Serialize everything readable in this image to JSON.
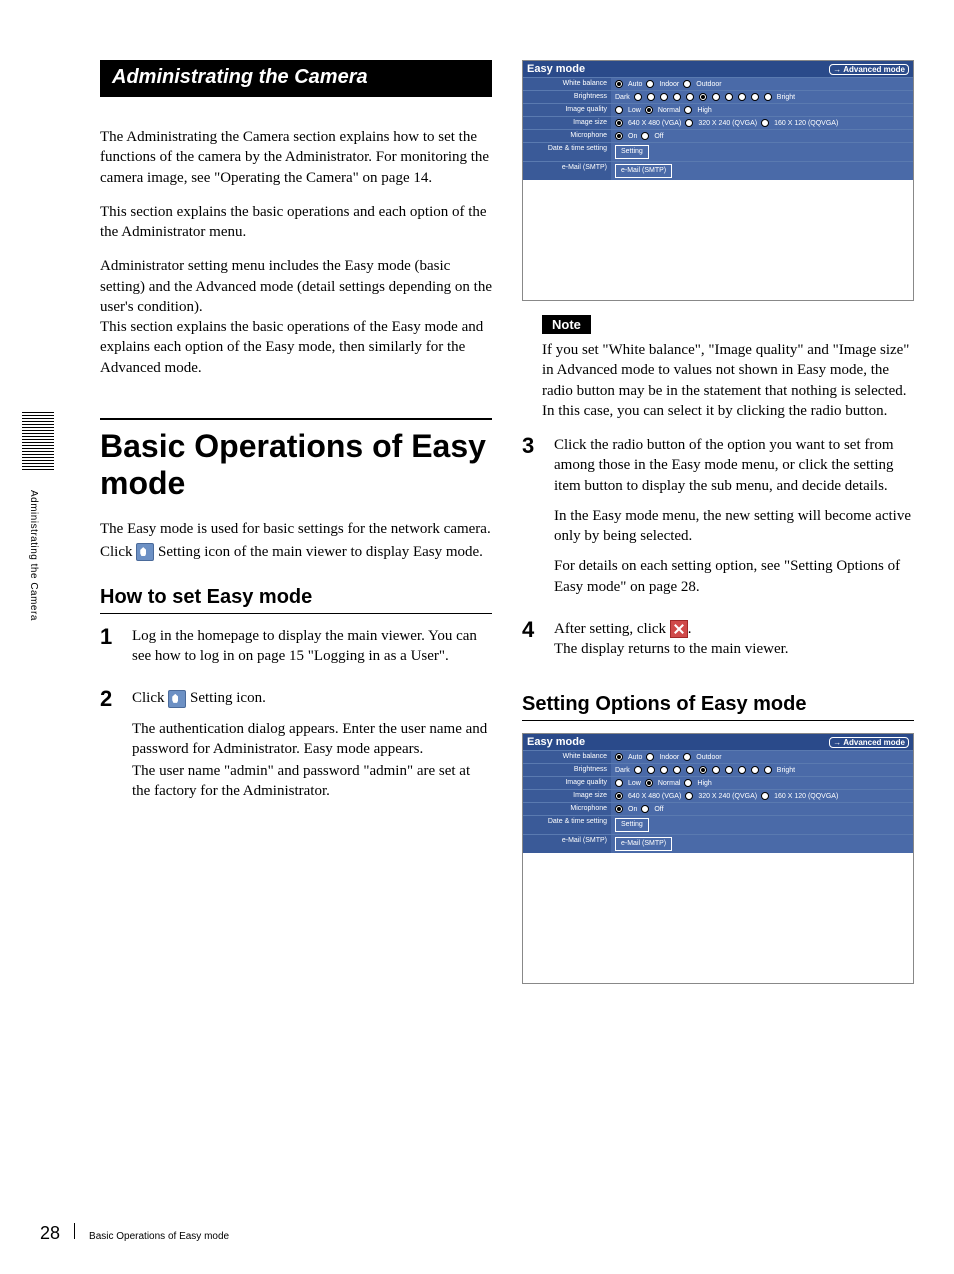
{
  "sideLabel": "Administrating the Camera",
  "footer": {
    "pageNum": "28",
    "text": "Basic Operations of Easy mode"
  },
  "left": {
    "banner": "Administrating the Camera",
    "p1": "The Administrating the Camera section explains how to set the functions of the camera by the Administrator. For monitoring the camera image, see \"Operating the Camera\" on page 14.",
    "p2": "This section explains the basic operations and each option of the the Administrator menu.",
    "p3a": "Administrator setting menu includes the Easy mode (basic setting) and the Advanced mode (detail settings depending on the user's condition).",
    "p3b": "This section explains the basic operations of the Easy mode and explains each option of the Easy mode, then similarly for the Advanced mode.",
    "title": "Basic Operations of Easy mode",
    "introA": "The Easy mode is used for basic settings for the network camera.",
    "introB_pre": "Click ",
    "introB_post": " Setting icon of the main viewer to display Easy mode.",
    "howTo": "How to set Easy mode",
    "steps": {
      "s1": "Log in the homepage to display the main viewer. You can see how to log in on page 15 \"Logging in as a User\".",
      "s2_pre": "Click ",
      "s2_post": " Setting icon.",
      "s2b": "The authentication dialog appears. Enter the user name and password for Administrator. Easy mode appears.",
      "s2c": "The user name \"admin\" and password \"admin\" are set at the factory for the Administrator."
    }
  },
  "right": {
    "noteChip": "Note",
    "noteText": "If you set \"White balance\", \"Image quality\" and \"Image size\" in Advanced mode to values not shown in Easy mode, the radio button may be in the statement that nothing is selected. In this case, you can select it by clicking the radio button.",
    "s3a": "Click the radio button of the option you want to set from among those in the Easy mode menu, or click the setting item button to display the sub menu, and decide details.",
    "s3b": "In the Easy mode menu, the new setting will become active only by being selected.",
    "s3c": "For details on each setting option, see \"Setting Options of Easy mode\" on page 28.",
    "s4_pre": "After setting, click ",
    "s4_post": ".",
    "s4b": "The display returns to the main viewer.",
    "settingOptions": "Setting Options of Easy mode"
  },
  "panel": {
    "title": "Easy mode",
    "advBtn": "Advanced mode",
    "rows": {
      "wb": {
        "label": "White balance",
        "opts": [
          "Auto",
          "Indoor",
          "Outdoor"
        ],
        "sel": 0
      },
      "bright": {
        "label": "Brightness",
        "left": "Dark",
        "right": "Bright",
        "count": 11,
        "sel": 5
      },
      "iq": {
        "label": "Image quality",
        "opts": [
          "Low",
          "Normal",
          "High"
        ],
        "sel": 1
      },
      "size": {
        "label": "Image size",
        "opts": [
          "640 X 480 (VGA)",
          "320 X 240 (QVGA)",
          "160 X 120 (QQVGA)"
        ],
        "sel": 0
      },
      "mic": {
        "label": "Microphone",
        "opts": [
          "On",
          "Off"
        ],
        "sel": 0
      },
      "dt": {
        "label": "Date & time setting",
        "btn": "Setting"
      },
      "mail": {
        "label": "e-Mail (SMTP)",
        "btn": "e-Mail (SMTP)"
      }
    }
  }
}
